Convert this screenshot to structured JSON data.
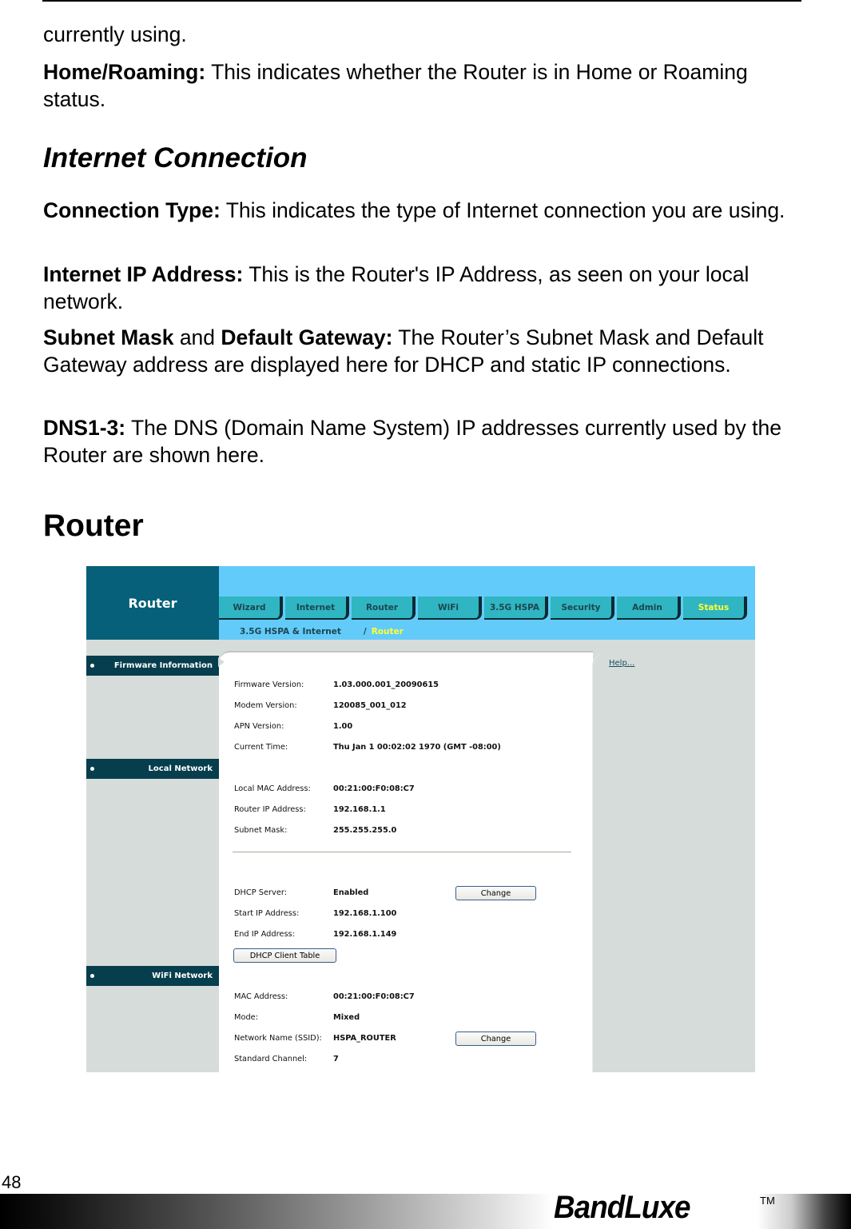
{
  "document": {
    "para_continued": "currently using.",
    "home_roaming": {
      "term": "Home/Roaming:",
      "text": " This indicates whether the Router is in Home or Roaming status."
    },
    "section_internet": "Internet Connection",
    "connection_type": {
      "term": "Connection Type:",
      "text": " This indicates the type of Internet connection you are using."
    },
    "internet_ip": {
      "term": "Internet IP Address:",
      "text": " This is the Router's IP Address, as seen on your local network."
    },
    "subnet_gateway": {
      "term1": "Subnet Mask",
      "mid": " and ",
      "term2": "Default Gateway:",
      "text": " The Router’s Subnet Mask and Default Gateway address are displayed here for DHCP and static IP connections."
    },
    "dns": {
      "term": "DNS1-3:",
      "text": " The DNS (Domain Name System) IP addresses currently used by the Router are shown here."
    },
    "section_router": "Router"
  },
  "screenshot": {
    "logo_title": "Router",
    "tabs": [
      {
        "label": "Wizard",
        "active": false
      },
      {
        "label": "Internet",
        "active": false
      },
      {
        "label": "Router",
        "active": false
      },
      {
        "label": "WiFi",
        "active": false
      },
      {
        "label": "3.5G HSPA",
        "active": false
      },
      {
        "label": "Security",
        "active": false
      },
      {
        "label": "Admin",
        "active": false
      },
      {
        "label": "Status",
        "active": true
      }
    ],
    "breadcrumb": {
      "parent": "3.5G HSPA & Internet",
      "separator": "/",
      "current": "Router"
    },
    "sections": {
      "firmware": "Firmware Information",
      "local": "Local Network",
      "wifi": "WiFi Network"
    },
    "help_link": "Help...",
    "firmware_rows": [
      {
        "label": "Firmware Version:",
        "value": "1.03.000.001_20090615"
      },
      {
        "label": "Modem Version:",
        "value": "120085_001_012"
      },
      {
        "label": "APN Version:",
        "value": "1.00"
      },
      {
        "label": "Current Time:",
        "value": "Thu Jan 1 00:02:02 1970 (GMT -08:00)"
      }
    ],
    "local_rows": [
      {
        "label": "Local MAC Address:",
        "value": "00:21:00:F0:08:C7"
      },
      {
        "label": "Router IP Address:",
        "value": "192.168.1.1"
      },
      {
        "label": "Subnet Mask:",
        "value": "255.255.255.0"
      }
    ],
    "dhcp_rows": [
      {
        "label": "DHCP Server:",
        "value": "Enabled"
      },
      {
        "label": "Start IP Address:",
        "value": "192.168.1.100"
      },
      {
        "label": "End IP Address:",
        "value": "192.168.1.149"
      }
    ],
    "dhcp_change_button": "Change",
    "dhcp_client_table_button": "DHCP Client Table",
    "wifi_rows": [
      {
        "label": "MAC Address:",
        "value": "00:21:00:F0:08:C7"
      },
      {
        "label": "Mode:",
        "value": "Mixed"
      },
      {
        "label": "Network Name (SSID):",
        "value": "HSPA_ROUTER"
      },
      {
        "label": "Standard Channel:",
        "value": "7"
      }
    ],
    "wifi_change_button": "Change",
    "colors": {
      "header_dark": "#066079",
      "topbar": "#63cbf9",
      "tab": "#2fb6c2",
      "active_tab_text": "#ffff33",
      "section_bar": "#063e4e",
      "panel_gray": "#d6dcda"
    }
  },
  "footer": {
    "page_number": "48",
    "brand": "BandLuxe",
    "trademark": "TM"
  }
}
